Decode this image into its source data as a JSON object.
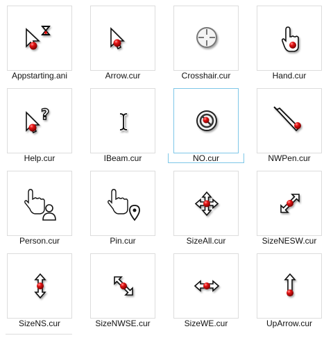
{
  "items": [
    {
      "label": "Appstarting.ani",
      "icon": "appstarting-cursor-icon"
    },
    {
      "label": "Arrow.cur",
      "icon": "arrow-cursor-icon"
    },
    {
      "label": "Crosshair.cur",
      "icon": "crosshair-cursor-icon"
    },
    {
      "label": "Hand.cur",
      "icon": "hand-cursor-icon"
    },
    {
      "label": "Help.cur",
      "icon": "help-cursor-icon"
    },
    {
      "label": "IBeam.cur",
      "icon": "ibeam-cursor-icon"
    },
    {
      "label": "NO.cur",
      "icon": "no-cursor-icon",
      "selected": true
    },
    {
      "label": "NWPen.cur",
      "icon": "pen-cursor-icon"
    },
    {
      "label": "Person.cur",
      "icon": "person-cursor-icon"
    },
    {
      "label": "Pin.cur",
      "icon": "pin-cursor-icon"
    },
    {
      "label": "SizeAll.cur",
      "icon": "size-all-cursor-icon"
    },
    {
      "label": "SizeNESW.cur",
      "icon": "size-nesw-cursor-icon"
    },
    {
      "label": "SizeNS.cur",
      "icon": "size-ns-cursor-icon"
    },
    {
      "label": "SizeNWSE.cur",
      "icon": "size-nwse-cursor-icon"
    },
    {
      "label": "SizeWE.cur",
      "icon": "size-we-cursor-icon"
    },
    {
      "label": "UpArrow.cur",
      "icon": "up-arrow-cursor-icon"
    }
  ],
  "colors": {
    "accent_red": "#e01010",
    "selection_border": "#7ec7e8"
  }
}
